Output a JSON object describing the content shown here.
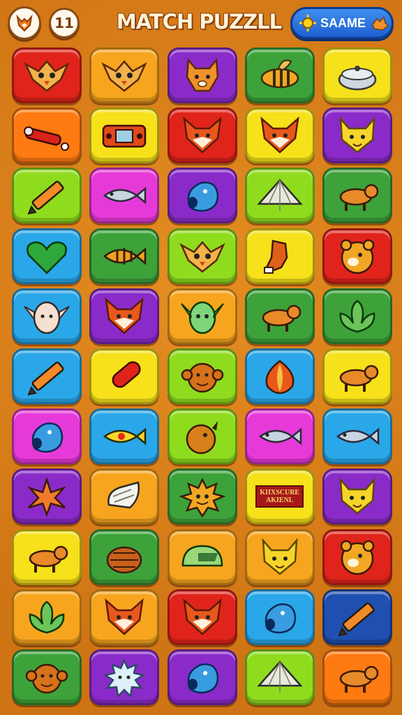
{
  "header": {
    "title": "MATCH PUZZLL",
    "level": "11",
    "same_button": "SAAME",
    "logo_icon": "fox-head-icon",
    "same_icons": [
      "sun-gear-icon",
      "fox-icon"
    ]
  },
  "colors": {
    "red": "#e0241b",
    "orange": "#ff7a10",
    "yellow": "#f6e11a",
    "lime": "#8fdc1e",
    "green": "#3da23a",
    "purple": "#8a2bc9",
    "magenta": "#e63ad8",
    "blue": "#2aa7e8",
    "navy": "#1f4fb0",
    "amber": "#f7a51e"
  },
  "board": {
    "rows": [
      [
        {
          "c": "red",
          "i": "owl-face"
        },
        {
          "c": "amber",
          "i": "owl-face"
        },
        {
          "c": "purple",
          "i": "dog-face"
        },
        {
          "c": "green",
          "i": "bee"
        },
        {
          "c": "yellow",
          "i": "cooking-pot"
        }
      ],
      [
        {
          "c": "orange",
          "i": "telescope"
        },
        {
          "c": "yellow",
          "i": "game-console"
        },
        {
          "c": "red",
          "i": "fox-face"
        },
        {
          "c": "yellow",
          "i": "fox-face"
        },
        {
          "c": "purple",
          "i": "cat-face"
        }
      ],
      [
        {
          "c": "lime",
          "i": "pencil"
        },
        {
          "c": "magenta",
          "i": "fish"
        },
        {
          "c": "purple",
          "i": "blob-creature"
        },
        {
          "c": "lime",
          "i": "tent"
        },
        {
          "c": "green",
          "i": "dog"
        }
      ],
      [
        {
          "c": "blue",
          "i": "heart"
        },
        {
          "c": "green",
          "i": "striped-fish"
        },
        {
          "c": "lime",
          "i": "owl-face"
        },
        {
          "c": "yellow",
          "i": "boot"
        },
        {
          "c": "red",
          "i": "bear-face"
        }
      ],
      [
        {
          "c": "blue",
          "i": "elf-face"
        },
        {
          "c": "purple",
          "i": "fox-face"
        },
        {
          "c": "amber",
          "i": "goblin-face"
        },
        {
          "c": "green",
          "i": "dog"
        },
        {
          "c": "green",
          "i": "leaf"
        }
      ],
      [
        {
          "c": "blue",
          "i": "pencil"
        },
        {
          "c": "yellow",
          "i": "red-tube"
        },
        {
          "c": "lime",
          "i": "monkey-face"
        },
        {
          "c": "blue",
          "i": "onion"
        },
        {
          "c": "yellow",
          "i": "dog"
        }
      ],
      [
        {
          "c": "magenta",
          "i": "blob-creature"
        },
        {
          "c": "blue",
          "i": "yellow-fish"
        },
        {
          "c": "lime",
          "i": "bird-head"
        },
        {
          "c": "magenta",
          "i": "fish"
        },
        {
          "c": "blue",
          "i": "fish"
        }
      ],
      [
        {
          "c": "purple",
          "i": "star-flower"
        },
        {
          "c": "amber",
          "i": "shell"
        },
        {
          "c": "green",
          "i": "sun-face"
        },
        {
          "c": "yellow",
          "i": "sign"
        },
        {
          "c": "purple",
          "i": "cat-face"
        }
      ],
      [
        {
          "c": "yellow",
          "i": "dog"
        },
        {
          "c": "green",
          "i": "turkey"
        },
        {
          "c": "amber",
          "i": "helmet"
        },
        {
          "c": "amber",
          "i": "cat-face"
        },
        {
          "c": "red",
          "i": "bear-face"
        }
      ],
      [
        {
          "c": "amber",
          "i": "leaf"
        },
        {
          "c": "amber",
          "i": "fox-face"
        },
        {
          "c": "red",
          "i": "fox-face"
        },
        {
          "c": "blue",
          "i": "blob-creature"
        },
        {
          "c": "navy",
          "i": "pencil"
        }
      ],
      [
        {
          "c": "green",
          "i": "monkey-face"
        },
        {
          "c": "purple",
          "i": "spiky-ball"
        },
        {
          "c": "purple",
          "i": "blob-creature"
        },
        {
          "c": "lime",
          "i": "tent"
        },
        {
          "c": "orange",
          "i": "dog"
        }
      ]
    ],
    "sign_text": "KIIXSCURE\nAKIENL"
  }
}
